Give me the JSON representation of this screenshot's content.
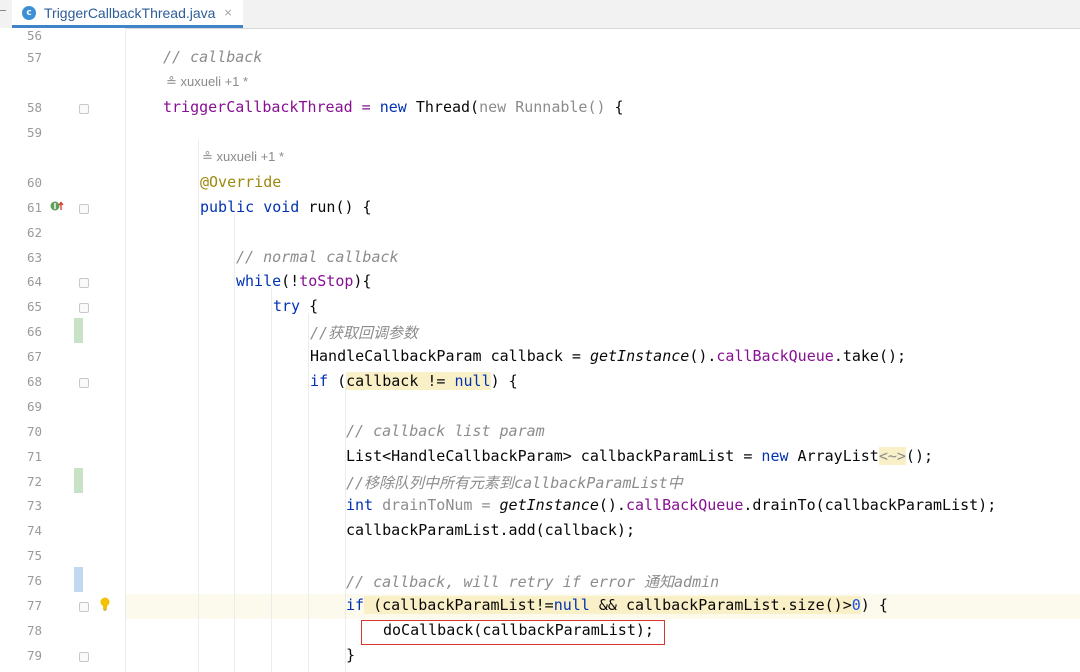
{
  "tab": {
    "filename": "TriggerCallbackThread.java",
    "icon_letter": "c",
    "close_glyph": "×"
  },
  "line_numbers": [
    "56",
    "57",
    "58",
    "59",
    "60",
    "61",
    "62",
    "63",
    "64",
    "65",
    "66",
    "67",
    "68",
    "69",
    "70",
    "71",
    "72",
    "73",
    "74",
    "75",
    "76",
    "77",
    "78",
    "79"
  ],
  "authors": {
    "a1": "xuxueli +1 *",
    "a2": "xuxueli +1 *"
  },
  "code": {
    "l57": "// callback",
    "l58_a": "triggerCallbackThread = ",
    "l58_b": "new",
    "l58_c": " Thread(",
    "l58_d": "new Runnable()",
    "l58_e": " {",
    "l60": "@Override",
    "l61_a": "public void",
    "l61_b": " run() {",
    "l63": "// normal callback",
    "l64_a": "while",
    "l64_b": "(!",
    "l64_c": "toStop",
    "l64_d": "){",
    "l65_a": "try",
    "l65_b": " {",
    "l66": "//获取回调参数",
    "l67_a": "HandleCallbackParam callback = ",
    "l67_b": "getInstance",
    "l67_c": "().",
    "l67_d": "callBackQueue",
    "l67_e": ".take();",
    "l68_a": "if",
    "l68_b": " (",
    "l68_c": "callback != ",
    "l68_d": "null",
    "l68_e": ") {",
    "l70": "// callback list param",
    "l71_a": "List<HandleCallbackParam> callbackParamList = ",
    "l71_b": "new",
    "l71_c": " ArrayList",
    "l71_d": "<~>",
    "l71_e": "();",
    "l72_a": "//移除队列中所有元素到",
    "l72_b": "callbackParamList",
    "l72_c": "中",
    "l73_a": "int",
    "l73_b": " drainToNum = ",
    "l73_c": "getInstance",
    "l73_d": "().",
    "l73_e": "callBackQueue",
    "l73_f": ".drainTo(callbackParamList);",
    "l74": "callbackParamList.add(callback);",
    "l76_a": "// callback, will retry if error ",
    "l76_b": "通知",
    "l76_c": "admin",
    "l77_a": "if",
    "l77_b": " (callbackParamList!=",
    "l77_c": "null",
    "l77_d": " && callbackParamList.size()>",
    "l77_e": "0",
    "l77_f": ") {",
    "l78": "doCallback(callbackParamList);",
    "l79": "}"
  },
  "colors": {
    "keyword": "#0033b3",
    "comment": "#8c8c8c",
    "field": "#871094",
    "number": "#1750eb",
    "annotation": "#9e880d",
    "highlight_box": "#d9342b"
  }
}
